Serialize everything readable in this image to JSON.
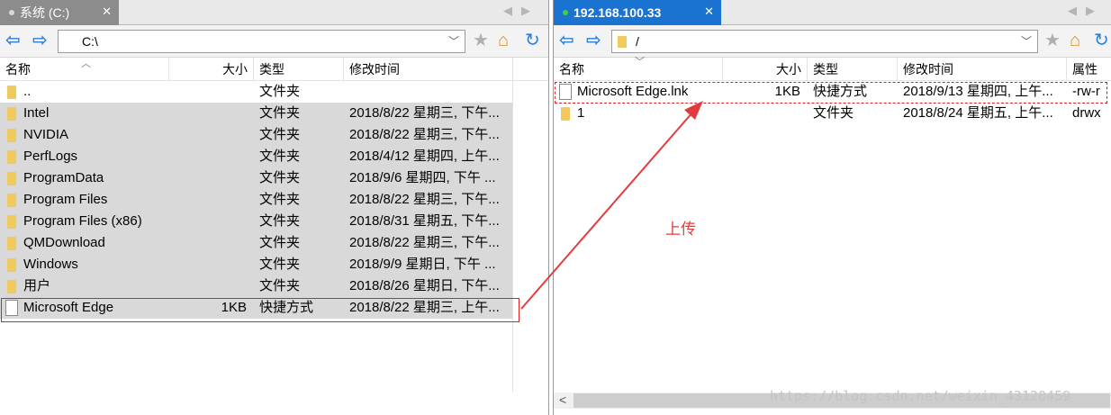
{
  "left": {
    "tab": {
      "label": "系统 (C:)",
      "close": "✕"
    },
    "path": "C:\\",
    "columns": {
      "name": "名称",
      "size": "大小",
      "type": "类型",
      "modified": "修改时间"
    },
    "rows": [
      {
        "name": "..",
        "size": "",
        "type": "文件夹",
        "modified": "",
        "icon": "folder-icon"
      },
      {
        "name": "Intel",
        "size": "",
        "type": "文件夹",
        "modified": "2018/8/22 星期三, 下午...",
        "icon": "folder-icon"
      },
      {
        "name": "NVIDIA",
        "size": "",
        "type": "文件夹",
        "modified": "2018/8/22 星期三, 下午...",
        "icon": "folder-icon"
      },
      {
        "name": "PerfLogs",
        "size": "",
        "type": "文件夹",
        "modified": "2018/4/12 星期四, 上午...",
        "icon": "folder-icon"
      },
      {
        "name": "ProgramData",
        "size": "",
        "type": "文件夹",
        "modified": "2018/9/6 星期四, 下午 ...",
        "icon": "folder-icon"
      },
      {
        "name": "Program Files",
        "size": "",
        "type": "文件夹",
        "modified": "2018/8/22 星期三, 下午...",
        "icon": "folder-icon"
      },
      {
        "name": "Program Files (x86)",
        "size": "",
        "type": "文件夹",
        "modified": "2018/8/31 星期五, 下午...",
        "icon": "folder-icon"
      },
      {
        "name": "QMDownload",
        "size": "",
        "type": "文件夹",
        "modified": "2018/8/22 星期三, 下午...",
        "icon": "folder-icon"
      },
      {
        "name": "Windows",
        "size": "",
        "type": "文件夹",
        "modified": "2018/9/9 星期日, 下午 ...",
        "icon": "folder-icon"
      },
      {
        "name": "用户",
        "size": "",
        "type": "文件夹",
        "modified": "2018/8/26 星期日, 下午...",
        "icon": "folder-icon"
      },
      {
        "name": "Microsoft Edge",
        "size": "1KB",
        "type": "快捷方式",
        "modified": "2018/8/22 星期三, 上午...",
        "icon": "shortcut-icon"
      }
    ]
  },
  "right": {
    "tab": {
      "label": "192.168.100.33",
      "close": "✕"
    },
    "path": "/",
    "columns": {
      "name": "名称",
      "size": "大小",
      "type": "类型",
      "modified": "修改时间",
      "attrs": "属性"
    },
    "rows": [
      {
        "name": "Microsoft Edge.lnk",
        "size": "1KB",
        "type": "快捷方式",
        "modified": "2018/9/13 星期四, 上午...",
        "attrs": "-rw-r",
        "icon": "file-icon"
      },
      {
        "name": "1",
        "size": "",
        "type": "文件夹",
        "modified": "2018/8/24 星期五, 上午...",
        "attrs": "drwx",
        "icon": "folder-icon"
      }
    ]
  },
  "annotation": {
    "label": "上传",
    "color": "#e23b3b"
  },
  "watermark": "https://blog.csdn.net/weixin_43120459",
  "colors": {
    "accent": "#1a73d1",
    "selection": "#d9d9d9",
    "folder": "#f1c95c"
  }
}
